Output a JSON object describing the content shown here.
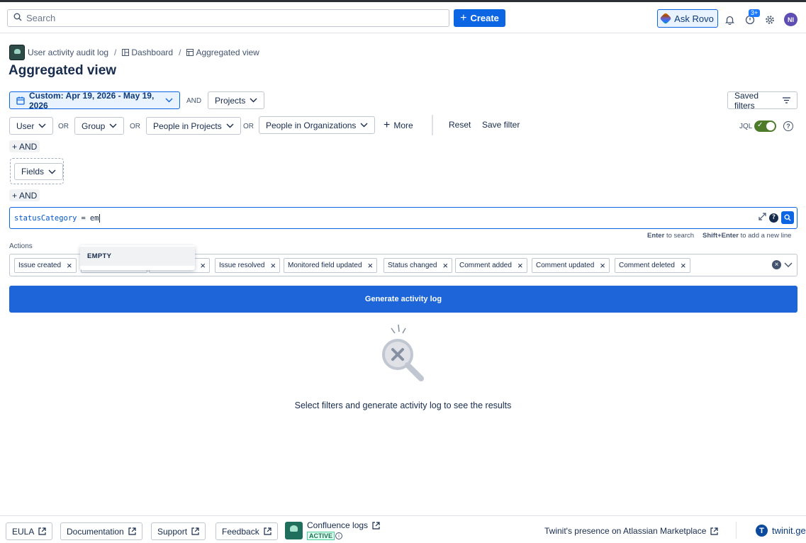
{
  "topbar": {
    "search_placeholder": "Search",
    "create_label": "Create",
    "rovo_label": "Ask Rovo",
    "notification_badge": "3+",
    "avatar_initials": "NI"
  },
  "breadcrumb": {
    "app": "User activity audit log",
    "dashboard": "Dashboard",
    "current": "Aggregated view",
    "sep": "/"
  },
  "page_title": "Aggregated view",
  "filters": {
    "date_range": "Custom: Apr 19, 2026 - May 19, 2026",
    "and_label": "AND",
    "projects": "Projects",
    "saved_filters": "Saved filters",
    "user": "User",
    "or_label": "OR",
    "group": "Group",
    "people_in_projects": "People in Projects",
    "people_in_orgs": "People in Organizations",
    "more": "More",
    "reset": "Reset",
    "save_filter": "Save filter",
    "jql_label": "JQL",
    "add_and": "AND",
    "fields": "Fields"
  },
  "jql": {
    "keyword": "statusCategory",
    "operator": "=",
    "value": "em",
    "hint_enter_key": "Enter",
    "hint_enter_text": "to search",
    "hint_shift_key": "Shift+Enter",
    "hint_shift_text": "to add a new line",
    "suggestion": "EMPTY"
  },
  "actions": {
    "label": "Actions",
    "chips": [
      "Issue created",
      "",
      "",
      "Issue resolved",
      "Monitored field updated",
      "Status changed",
      "Comment added",
      "Comment updated",
      "Comment deleted"
    ]
  },
  "generate_label": "Generate activity log",
  "empty_message": "Select filters and generate activity log to see the results",
  "footer": {
    "eula": "EULA",
    "documentation": "Documentation",
    "support": "Support",
    "feedback": "Feedback",
    "confluence_logs": "Confluence logs",
    "active": "ACTIVE",
    "marketplace": "Twinit's presence on Atlassian Marketplace",
    "brand": "twinit.ge"
  },
  "colors": {
    "primary": "#0c66e4",
    "generate": "#1d65d8",
    "toggle_on": "#4d7b2a"
  }
}
